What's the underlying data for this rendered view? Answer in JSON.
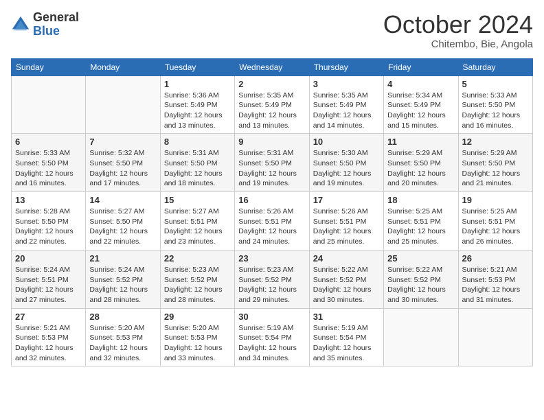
{
  "logo": {
    "general": "General",
    "blue": "Blue"
  },
  "header": {
    "month": "October 2024",
    "location": "Chitembo, Bie, Angola"
  },
  "weekdays": [
    "Sunday",
    "Monday",
    "Tuesday",
    "Wednesday",
    "Thursday",
    "Friday",
    "Saturday"
  ],
  "weeks": [
    [
      {
        "day": "",
        "info": ""
      },
      {
        "day": "",
        "info": ""
      },
      {
        "day": "1",
        "info": "Sunrise: 5:36 AM\nSunset: 5:49 PM\nDaylight: 12 hours and 13 minutes."
      },
      {
        "day": "2",
        "info": "Sunrise: 5:35 AM\nSunset: 5:49 PM\nDaylight: 12 hours and 13 minutes."
      },
      {
        "day": "3",
        "info": "Sunrise: 5:35 AM\nSunset: 5:49 PM\nDaylight: 12 hours and 14 minutes."
      },
      {
        "day": "4",
        "info": "Sunrise: 5:34 AM\nSunset: 5:49 PM\nDaylight: 12 hours and 15 minutes."
      },
      {
        "day": "5",
        "info": "Sunrise: 5:33 AM\nSunset: 5:50 PM\nDaylight: 12 hours and 16 minutes."
      }
    ],
    [
      {
        "day": "6",
        "info": "Sunrise: 5:33 AM\nSunset: 5:50 PM\nDaylight: 12 hours and 16 minutes."
      },
      {
        "day": "7",
        "info": "Sunrise: 5:32 AM\nSunset: 5:50 PM\nDaylight: 12 hours and 17 minutes."
      },
      {
        "day": "8",
        "info": "Sunrise: 5:31 AM\nSunset: 5:50 PM\nDaylight: 12 hours and 18 minutes."
      },
      {
        "day": "9",
        "info": "Sunrise: 5:31 AM\nSunset: 5:50 PM\nDaylight: 12 hours and 19 minutes."
      },
      {
        "day": "10",
        "info": "Sunrise: 5:30 AM\nSunset: 5:50 PM\nDaylight: 12 hours and 19 minutes."
      },
      {
        "day": "11",
        "info": "Sunrise: 5:29 AM\nSunset: 5:50 PM\nDaylight: 12 hours and 20 minutes."
      },
      {
        "day": "12",
        "info": "Sunrise: 5:29 AM\nSunset: 5:50 PM\nDaylight: 12 hours and 21 minutes."
      }
    ],
    [
      {
        "day": "13",
        "info": "Sunrise: 5:28 AM\nSunset: 5:50 PM\nDaylight: 12 hours and 22 minutes."
      },
      {
        "day": "14",
        "info": "Sunrise: 5:27 AM\nSunset: 5:50 PM\nDaylight: 12 hours and 22 minutes."
      },
      {
        "day": "15",
        "info": "Sunrise: 5:27 AM\nSunset: 5:51 PM\nDaylight: 12 hours and 23 minutes."
      },
      {
        "day": "16",
        "info": "Sunrise: 5:26 AM\nSunset: 5:51 PM\nDaylight: 12 hours and 24 minutes."
      },
      {
        "day": "17",
        "info": "Sunrise: 5:26 AM\nSunset: 5:51 PM\nDaylight: 12 hours and 25 minutes."
      },
      {
        "day": "18",
        "info": "Sunrise: 5:25 AM\nSunset: 5:51 PM\nDaylight: 12 hours and 25 minutes."
      },
      {
        "day": "19",
        "info": "Sunrise: 5:25 AM\nSunset: 5:51 PM\nDaylight: 12 hours and 26 minutes."
      }
    ],
    [
      {
        "day": "20",
        "info": "Sunrise: 5:24 AM\nSunset: 5:51 PM\nDaylight: 12 hours and 27 minutes."
      },
      {
        "day": "21",
        "info": "Sunrise: 5:24 AM\nSunset: 5:52 PM\nDaylight: 12 hours and 28 minutes."
      },
      {
        "day": "22",
        "info": "Sunrise: 5:23 AM\nSunset: 5:52 PM\nDaylight: 12 hours and 28 minutes."
      },
      {
        "day": "23",
        "info": "Sunrise: 5:23 AM\nSunset: 5:52 PM\nDaylight: 12 hours and 29 minutes."
      },
      {
        "day": "24",
        "info": "Sunrise: 5:22 AM\nSunset: 5:52 PM\nDaylight: 12 hours and 30 minutes."
      },
      {
        "day": "25",
        "info": "Sunrise: 5:22 AM\nSunset: 5:52 PM\nDaylight: 12 hours and 30 minutes."
      },
      {
        "day": "26",
        "info": "Sunrise: 5:21 AM\nSunset: 5:53 PM\nDaylight: 12 hours and 31 minutes."
      }
    ],
    [
      {
        "day": "27",
        "info": "Sunrise: 5:21 AM\nSunset: 5:53 PM\nDaylight: 12 hours and 32 minutes."
      },
      {
        "day": "28",
        "info": "Sunrise: 5:20 AM\nSunset: 5:53 PM\nDaylight: 12 hours and 32 minutes."
      },
      {
        "day": "29",
        "info": "Sunrise: 5:20 AM\nSunset: 5:53 PM\nDaylight: 12 hours and 33 minutes."
      },
      {
        "day": "30",
        "info": "Sunrise: 5:19 AM\nSunset: 5:54 PM\nDaylight: 12 hours and 34 minutes."
      },
      {
        "day": "31",
        "info": "Sunrise: 5:19 AM\nSunset: 5:54 PM\nDaylight: 12 hours and 35 minutes."
      },
      {
        "day": "",
        "info": ""
      },
      {
        "day": "",
        "info": ""
      }
    ]
  ]
}
